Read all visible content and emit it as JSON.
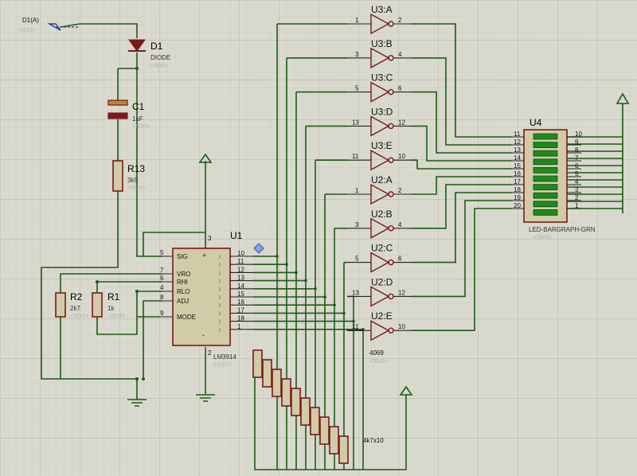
{
  "probe": {
    "label": "D1(A)",
    "text": "<TEXT>"
  },
  "diode": {
    "ref": "D1",
    "value": "DIODE",
    "text": "<TEXT>"
  },
  "capacitor": {
    "ref": "C1",
    "value": "1uF",
    "text": "<TEXT>"
  },
  "r13": {
    "ref": "R13",
    "value": "3k9",
    "text": "<TEXT>"
  },
  "r2": {
    "ref": "R2",
    "value": "2k7",
    "text": "<TEXT>"
  },
  "r1": {
    "ref": "R1",
    "value": "1k",
    "text": "<TEXT>"
  },
  "u1": {
    "ref": "U1",
    "value": "LM3914",
    "text": "<TEXT>",
    "left_pins": [
      {
        "num": "5",
        "name": "SIG"
      },
      {
        "num": "7",
        "name": "VRO"
      },
      {
        "num": "6",
        "name": "RHI"
      },
      {
        "num": "4",
        "name": "RLO"
      },
      {
        "num": "8",
        "name": "ADJ"
      },
      {
        "num": "9",
        "name": "MODE"
      }
    ],
    "right_pins": [
      "10",
      "11",
      "12",
      "13",
      "14",
      "15",
      "16",
      "17",
      "18",
      "1"
    ],
    "top_pin": "3",
    "bottom_pin": "2"
  },
  "inverters": [
    {
      "ref": "U3:A",
      "in": "1",
      "out": "2"
    },
    {
      "ref": "U3:B",
      "in": "3",
      "out": "4"
    },
    {
      "ref": "U3:C",
      "in": "5",
      "out": "6"
    },
    {
      "ref": "U3:D",
      "in": "13",
      "out": "12"
    },
    {
      "ref": "U3:E",
      "in": "11",
      "out": "10"
    },
    {
      "ref": "U2:A",
      "in": "1",
      "out": "2"
    },
    {
      "ref": "U2:B",
      "in": "3",
      "out": "4"
    },
    {
      "ref": "U2:C",
      "in": "5",
      "out": "6"
    },
    {
      "ref": "U2:D",
      "in": "13",
      "out": "12"
    },
    {
      "ref": "U2:E",
      "in": "11",
      "out": "10"
    }
  ],
  "inverter_part": {
    "value": "4069",
    "text": "<TEXT>"
  },
  "u4": {
    "ref": "U4",
    "value": "LED-BARGRAPH-GRN",
    "text": "<TEXT>",
    "left_pins": [
      "11",
      "12",
      "13",
      "14",
      "15",
      "16",
      "17",
      "18",
      "19",
      "20"
    ],
    "right_pins": [
      "10",
      "9",
      "8",
      "7",
      "6",
      "5",
      "4",
      "3",
      "2",
      "1"
    ]
  },
  "resistor_array": {
    "value": "4k7x10"
  },
  "colors": {
    "background": "#d9d9ce",
    "grid": "#bdbdb0",
    "wire": "#1d5a16",
    "component": "#7a1a1a",
    "body": "#d2cba8",
    "led": "#1e8a1e"
  }
}
